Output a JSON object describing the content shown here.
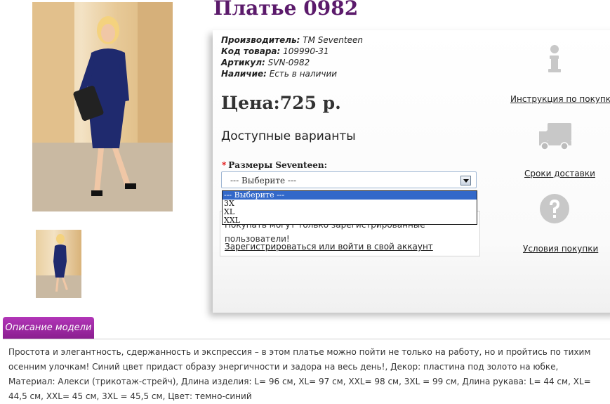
{
  "product": {
    "title": "Платье 0982",
    "meta": [
      {
        "label": "Производитель:",
        "value": "TM Seventeen"
      },
      {
        "label": "Код товара:",
        "value": "109990-31"
      },
      {
        "label": "Артикул:",
        "value": "SVN-0982"
      },
      {
        "label": "Наличие:",
        "value": "Есть в наличии"
      }
    ],
    "price": "Цена:725 р.",
    "variants_heading": "Доступные варианты"
  },
  "size_select": {
    "label": "Размеры Seventeen:",
    "required_mark": "*",
    "selected": "--- Выберите ---",
    "options": [
      "--- Выберите ---",
      "3X",
      "XL",
      "XXL"
    ]
  },
  "notice": {
    "text": "Покупать могут только зарегистрированные пользователи!",
    "link": "Зарегистрироваться или войти в свой аккаунт"
  },
  "side_links": [
    {
      "label": "Инструкция по покупке",
      "icon": "info-icon"
    },
    {
      "label": "Сроки доставки",
      "icon": "truck-icon"
    },
    {
      "label": "Условия покупки",
      "icon": "question-icon"
    }
  ],
  "description": {
    "tab_label": "Описание модели",
    "text": "Простота и элегантность, сдержанность и экспрессия – в этом платье можно пойти не только на работу, но и пройтись по тихим осенним улочкам! Синий цвет придаст образу энергичности и задора на весь день!, Декор: пластина под золото на юбке, Материал: Алекси (трикотаж-стрейч), Длина изделия: L= 96 см, XL= 97 см, XXL= 98 см, 3XL = 99 см, Длина рукава: L= 44 см, XL= 44,5 см, XXL= 45 см, 3XL = 45,5 см, Цвет: темно-синий"
  },
  "colors": {
    "title": "#5b1a6b",
    "tab": "#9b2aa1",
    "select_highlight": "#3268c9",
    "required": "#e00000",
    "dress": "#1f2a6e"
  }
}
